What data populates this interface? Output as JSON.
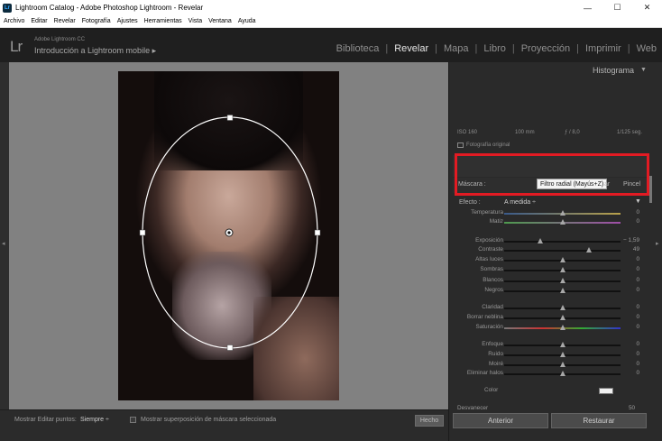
{
  "window": {
    "title": "Lightroom Catalog - Adobe Photoshop Lightroom - Revelar",
    "app_icon": "Lr",
    "minimize": "—",
    "maximize": "☐",
    "close": "✕"
  },
  "menu": [
    "Archivo",
    "Editar",
    "Revelar",
    "Fotografía",
    "Ajustes",
    "Herramientas",
    "Vista",
    "Ventana",
    "Ayuda"
  ],
  "identity": {
    "logo": "Lr",
    "product": "Adobe Lightroom CC",
    "catalog": "Introducción a Lightroom mobile",
    "catalog_arrow": "▸"
  },
  "modules": {
    "items": [
      "Biblioteca",
      "Revelar",
      "Mapa",
      "Libro",
      "Proyección",
      "Imprimir",
      "Web"
    ],
    "active": "Revelar",
    "separator": "|"
  },
  "histogram": {
    "title": "Histograma",
    "collapse_icon": "triangle-down-icon",
    "iso": "ISO 160",
    "focal": "100 mm",
    "aperture": "ƒ / 8,0",
    "shutter": "1/125 seg.",
    "original_label": "Fotografía original"
  },
  "mask": {
    "label": "Máscara :",
    "tooltip": "Filtro radial (Mayús+Z)",
    "ar_label": "ar",
    "brush_label": "Pincel"
  },
  "effect": {
    "label": "Efecto :",
    "value": "A medida ÷",
    "toggle": "▼"
  },
  "sliders": [
    {
      "label": "Temperatura",
      "value": "0",
      "position": 0.5
    },
    {
      "label": "Matiz",
      "value": "0",
      "position": 0.5
    },
    {
      "label": "Exposición",
      "value": "− 1,59",
      "position": 0.31
    },
    {
      "label": "Contraste",
      "value": "49",
      "position": 0.73
    },
    {
      "label": "Altas luces",
      "value": "0",
      "position": 0.5
    },
    {
      "label": "Sombras",
      "value": "0",
      "position": 0.5
    },
    {
      "label": "Blancos",
      "value": "0",
      "position": 0.5
    },
    {
      "label": "Negros",
      "value": "0",
      "position": 0.5
    },
    {
      "label": "Claridad",
      "value": "0",
      "position": 0.5
    },
    {
      "label": "Borrar neblina",
      "value": "0",
      "position": 0.5
    },
    {
      "label": "Saturación",
      "value": "0",
      "position": 0.5
    },
    {
      "label": "Enfoque",
      "value": "0",
      "position": 0.5
    },
    {
      "label": "Ruido",
      "value": "0",
      "position": 0.5
    },
    {
      "label": "Moiré",
      "value": "0",
      "position": 0.5
    },
    {
      "label": "Eliminar halos",
      "value": "0",
      "position": 0.5
    }
  ],
  "color_row": {
    "label": "Color"
  },
  "partial_section": {
    "label": "Desvanecer",
    "value": "50"
  },
  "toolbar": {
    "show_pins_label": "Mostrar Editar puntos:",
    "show_pins_value": "Siempre ÷",
    "overlay_label": "Mostrar superposición de máscara seleccionada",
    "done": "Hecho"
  },
  "footer_buttons": {
    "previous": "Anterior",
    "reset": "Restaurar"
  },
  "accent_colors": {
    "highlight_box": "#e21b23",
    "active_module": "#e6e6e6"
  }
}
